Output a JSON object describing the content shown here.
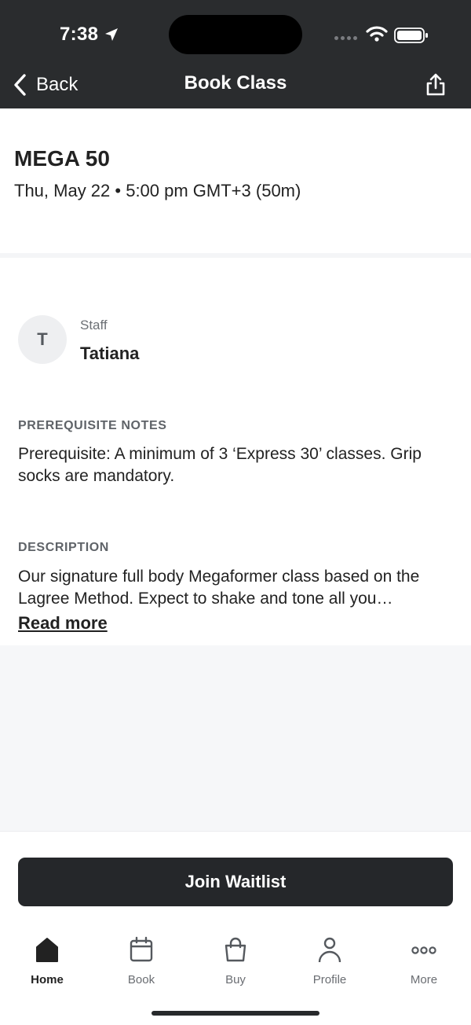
{
  "status_bar": {
    "time": "7:38"
  },
  "nav": {
    "back_label": "Back",
    "title": "Book Class"
  },
  "class_info": {
    "name": "MEGA 50",
    "datetime": "Thu, May 22 • 5:00 pm GMT+3 (50m)"
  },
  "staff": {
    "label": "Staff",
    "initial": "T",
    "name": "Tatiana"
  },
  "prerequisite": {
    "heading": "PREREQUISITE NOTES",
    "text": "Prerequisite: A minimum of 3 ‘Express 30’ classes. Grip socks are mandatory."
  },
  "description": {
    "heading": "DESCRIPTION",
    "text": "Our signature full body Megaformer class based on the Lagree Method. Expect to shake and tone all you…",
    "read_more": "Read more"
  },
  "action": {
    "button_label": "Join Waitlist"
  },
  "tabs": [
    {
      "label": "Home",
      "icon": "home-icon",
      "active": true
    },
    {
      "label": "Book",
      "icon": "calendar-icon",
      "active": false
    },
    {
      "label": "Buy",
      "icon": "shopping-bag-icon",
      "active": false
    },
    {
      "label": "Profile",
      "icon": "person-icon",
      "active": false
    },
    {
      "label": "More",
      "icon": "more-dots-icon",
      "active": false
    }
  ],
  "colors": {
    "header_bg": "#2a2c2e",
    "button_bg": "#25272a",
    "page_grey": "#f6f7f9"
  }
}
